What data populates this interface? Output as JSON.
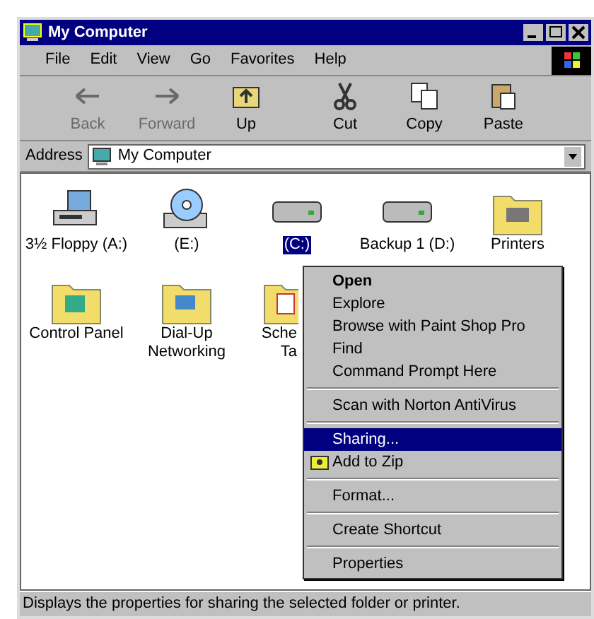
{
  "window": {
    "title": "My Computer"
  },
  "menu_bar": [
    {
      "label": "File"
    },
    {
      "label": "Edit"
    },
    {
      "label": "View"
    },
    {
      "label": "Go"
    },
    {
      "label": "Favorites"
    },
    {
      "label": "Help"
    }
  ],
  "toolbar": [
    {
      "kind": "back",
      "label": "Back",
      "disabled": true
    },
    {
      "kind": "forward",
      "label": "Forward",
      "disabled": true
    },
    {
      "kind": "up",
      "label": "Up",
      "disabled": false
    },
    {
      "kind": "cut",
      "label": "Cut",
      "disabled": false
    },
    {
      "kind": "copy",
      "label": "Copy",
      "disabled": false
    },
    {
      "kind": "paste",
      "label": "Paste",
      "disabled": false
    }
  ],
  "address": {
    "label": "Address",
    "value": "My Computer"
  },
  "items": [
    {
      "kind": "floppy",
      "label": "3½ Floppy (A:)",
      "selected": false
    },
    {
      "kind": "cdrom",
      "label": "(E:)",
      "selected": false
    },
    {
      "kind": "drive",
      "label": "(C:)",
      "selected": true
    },
    {
      "kind": "drive",
      "label": "Backup 1 (D:)",
      "selected": false
    },
    {
      "kind": "printers",
      "label": "Printers",
      "selected": false
    },
    {
      "kind": "control",
      "label": "Control Panel",
      "selected": false
    },
    {
      "kind": "dialup",
      "label": "Dial-Up Networking",
      "selected": false
    },
    {
      "kind": "tasks",
      "label": "Sche\nTa",
      "selected": false
    }
  ],
  "context_menu": [
    {
      "kind": "item",
      "label": "Open",
      "default": true,
      "selected": false
    },
    {
      "kind": "item",
      "label": "Explore",
      "default": false,
      "selected": false
    },
    {
      "kind": "item",
      "label": "Browse with Paint Shop Pro",
      "default": false,
      "selected": false
    },
    {
      "kind": "item",
      "label": "Find",
      "default": false,
      "selected": false
    },
    {
      "kind": "item",
      "label": "Command Prompt Here",
      "default": false,
      "selected": false
    },
    {
      "kind": "separator"
    },
    {
      "kind": "item",
      "label": "Scan with Norton AntiVirus",
      "default": false,
      "selected": false
    },
    {
      "kind": "separator"
    },
    {
      "kind": "item",
      "label": "Sharing...",
      "default": false,
      "selected": true
    },
    {
      "kind": "zip",
      "label": "Add to Zip",
      "default": false,
      "selected": false
    },
    {
      "kind": "separator"
    },
    {
      "kind": "item",
      "label": "Format...",
      "default": false,
      "selected": false
    },
    {
      "kind": "separator"
    },
    {
      "kind": "item",
      "label": "Create Shortcut",
      "default": false,
      "selected": false
    },
    {
      "kind": "separator"
    },
    {
      "kind": "item",
      "label": "Properties",
      "default": false,
      "selected": false
    }
  ],
  "status_bar": "Displays the properties for sharing the selected folder or printer."
}
